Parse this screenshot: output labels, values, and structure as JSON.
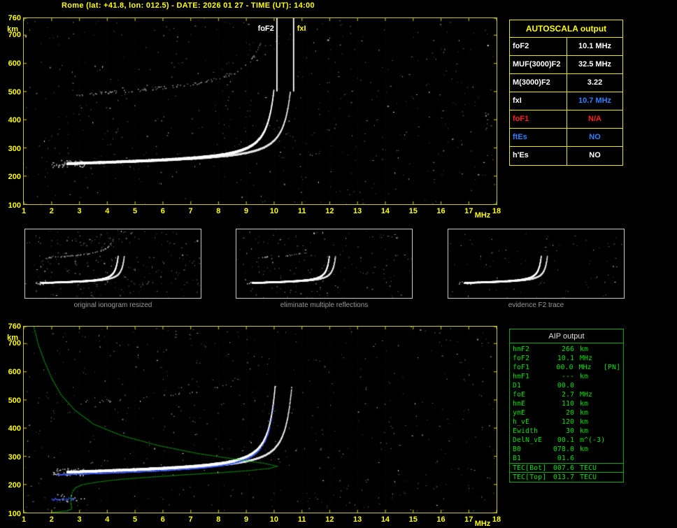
{
  "title": "Rome (lat: +41.8, lon: 012.5) - DATE: 2026 01 27 - TIME (UT): 14:00",
  "colors": {
    "axis": "#ffff00",
    "autoscala_border": "#e8e800",
    "aip_border": "#00aa00",
    "aip_text": "#00dd00",
    "trace": "#ffffff",
    "profile_green": "#00cc00",
    "scaled_trace_blue": "#4060ff",
    "caption_gray": "#989898",
    "alert_red": "#ff2020",
    "info_blue": "#2f7fff"
  },
  "main_ionogram": {
    "y_unit": "km",
    "x_unit": "MHz",
    "y_ticks": [
      760,
      700,
      600,
      500,
      400,
      300,
      200,
      100
    ],
    "x_ticks": [
      1,
      2,
      3,
      4,
      5,
      6,
      7,
      8,
      9,
      10,
      11,
      12,
      13,
      14,
      15,
      16,
      17,
      18
    ],
    "markers": [
      {
        "label": "foF2",
        "freq_MHz": 10.1,
        "label_color": "#ffffff"
      },
      {
        "label": "fxI",
        "freq_MHz": 10.7,
        "label_color": "#ffff00"
      }
    ]
  },
  "restored_ionogram": {
    "y_unit": "km",
    "x_unit": "MHz",
    "y_ticks": [
      760,
      700,
      600,
      500,
      400,
      300,
      200,
      100
    ],
    "x_ticks": [
      1,
      2,
      3,
      4,
      5,
      6,
      7,
      8,
      9,
      10,
      11,
      12,
      13,
      14,
      15,
      16,
      17,
      18
    ]
  },
  "autoscala_table": {
    "title": "AUTOSCALA output",
    "rows": [
      {
        "label": "foF2",
        "value": "10.1 MHz",
        "label_color": "#ffffff",
        "value_color": "#ffffff"
      },
      {
        "label": "MUF(3000)F2",
        "value": "32.5 MHz",
        "label_color": "#ffffff",
        "value_color": "#ffffff"
      },
      {
        "label": "M(3000)F2",
        "value": "3.22",
        "label_color": "#ffffff",
        "value_color": "#ffffff"
      },
      {
        "label": "fxI",
        "value": "10.7 MHz",
        "label_color": "#ffffff",
        "value_color": "#2f7fff"
      },
      {
        "label": "foF1",
        "value": "N/A",
        "label_color": "#ff2020",
        "value_color": "#ff2020"
      },
      {
        "label": "ftEs",
        "value": "NO",
        "label_color": "#2f7fff",
        "value_color": "#2f7fff"
      },
      {
        "label": "h'Es",
        "value": "NO",
        "label_color": "#ffffff",
        "value_color": "#ffffff"
      }
    ]
  },
  "thumbnails": [
    {
      "caption": "original ionogram resized"
    },
    {
      "caption": "eliminate multiple reflections"
    },
    {
      "caption": "evidence F2 trace"
    }
  ],
  "aip_table": {
    "title": "AIP output",
    "rows": [
      {
        "label": "hmF2",
        "value": "266",
        "unit": "km",
        "extra": ""
      },
      {
        "label": "foF2",
        "value": "10.1",
        "unit": "MHz",
        "extra": ""
      },
      {
        "label": "foF1",
        "value": "00.0",
        "unit": "MHz",
        "extra": "[PN]"
      },
      {
        "label": "hmF1",
        "value": "---",
        "unit": "km",
        "extra": ""
      },
      {
        "label": "D1",
        "value": "00.0",
        "unit": "",
        "extra": ""
      },
      {
        "label": "foE",
        "value": "2.7",
        "unit": "MHz",
        "extra": ""
      },
      {
        "label": "hmE",
        "value": "110",
        "unit": "km",
        "extra": ""
      },
      {
        "label": "ymE",
        "value": "20",
        "unit": "km",
        "extra": ""
      },
      {
        "label": "h_vE",
        "value": "120",
        "unit": "km",
        "extra": ""
      },
      {
        "label": "Ewidth",
        "value": "30",
        "unit": "km",
        "extra": ""
      },
      {
        "label": "DelN_vE",
        "value": "00.1",
        "unit": "m^(-3)",
        "extra": ""
      },
      {
        "label": "B0",
        "value": "078.0",
        "unit": "km",
        "extra": ""
      },
      {
        "label": "B1",
        "value": "01.6",
        "unit": "",
        "extra": ""
      }
    ],
    "tec_rows": [
      {
        "label": "TEC[Bot]",
        "value": "007.6",
        "unit": "TECU"
      },
      {
        "label": "TEC[Top]",
        "value": "013.7",
        "unit": "TECU"
      }
    ]
  },
  "chart_data": {
    "type": "scatter",
    "title": "Ionogram: virtual height vs sounding frequency with restored traces and electron density profile",
    "xlabel": "MHz",
    "ylabel": "km",
    "xlim": [
      1,
      18
    ],
    "ylim": [
      100,
      760
    ],
    "foF2_MHz": 10.1,
    "fxI_MHz": 10.7,
    "foE_MHz": 2.7,
    "hmF2_km": 266,
    "trace_start_MHz": 2.55,
    "xtrace_start_MHz": 4.8,
    "trace_top_km": 500,
    "trace_shape": {
      "base": 240,
      "slope": 2.5,
      "amp": 55,
      "pow": 1.2,
      "eps": 0.15
    },
    "o_trace_sample": [
      [
        3,
        245
      ],
      [
        4,
        249
      ],
      [
        5,
        253
      ],
      [
        6,
        257
      ],
      [
        7,
        264
      ],
      [
        8,
        274
      ],
      [
        9,
        298
      ],
      [
        9.5,
        336
      ],
      [
        9.9,
        430
      ],
      [
        10.05,
        500
      ]
    ],
    "x_trace_sample": [
      [
        5,
        252
      ],
      [
        6,
        255
      ],
      [
        7,
        260
      ],
      [
        8,
        268
      ],
      [
        9,
        283
      ],
      [
        10,
        326
      ],
      [
        10.5,
        400
      ],
      [
        10.65,
        480
      ]
    ],
    "profile_points": [
      [
        1.35,
        760
      ],
      [
        1.5,
        700
      ],
      [
        1.72,
        640
      ],
      [
        1.98,
        580
      ],
      [
        2.32,
        520
      ],
      [
        2.82,
        465
      ],
      [
        3.5,
        415
      ],
      [
        4.5,
        375
      ],
      [
        5.8,
        340
      ],
      [
        7.2,
        312
      ],
      [
        8.6,
        291
      ],
      [
        9.6,
        277
      ],
      [
        10.1,
        266
      ],
      [
        9.8,
        258
      ],
      [
        9.0,
        250
      ],
      [
        8.0,
        243
      ],
      [
        6.8,
        236
      ],
      [
        5.6,
        228
      ],
      [
        4.5,
        220
      ],
      [
        3.7,
        211
      ],
      [
        3.1,
        201
      ],
      [
        2.85,
        190
      ],
      [
        2.75,
        178
      ],
      [
        2.7,
        164
      ],
      [
        2.68,
        150
      ],
      [
        2.68,
        136
      ],
      [
        2.7,
        124
      ],
      [
        2.7,
        114
      ],
      [
        2.55,
        108
      ],
      [
        2.2,
        104
      ],
      [
        1.95,
        102
      ]
    ]
  }
}
